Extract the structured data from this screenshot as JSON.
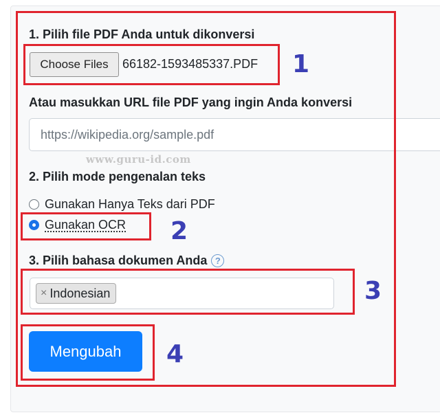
{
  "section1": {
    "title": "1. Pilih file PDF Anda untuk dikonversi",
    "choose_button": "Choose Files",
    "file_name": "66182-1593485337.PDF"
  },
  "url_section": {
    "title": "Atau masukkan URL file PDF yang ingin Anda konversi",
    "placeholder": "https://wikipedia.org/sample.pdf"
  },
  "watermark": "www.guru-id.com",
  "section2": {
    "title": "2. Pilih mode pengenalan teks",
    "options": [
      {
        "label": "Gunakan Hanya Teks dari PDF",
        "selected": false
      },
      {
        "label": "Gunakan OCR",
        "selected": true
      }
    ]
  },
  "section3": {
    "title": "3. Pilih bahasa dokumen Anda",
    "help_icon": "question-circle-icon",
    "help_glyph": "?",
    "selected_language": "Indonesian",
    "remove_glyph": "×"
  },
  "submit": {
    "label": "Mengubah"
  },
  "annotations": {
    "step_1": "1",
    "step_2": "2",
    "step_3": "3",
    "step_4": "4",
    "highlight_color": "#e0242e",
    "number_color": "#3b3fb4"
  },
  "colors": {
    "primary_button": "#0d7eff",
    "radio_selected": "#1a73e8"
  }
}
